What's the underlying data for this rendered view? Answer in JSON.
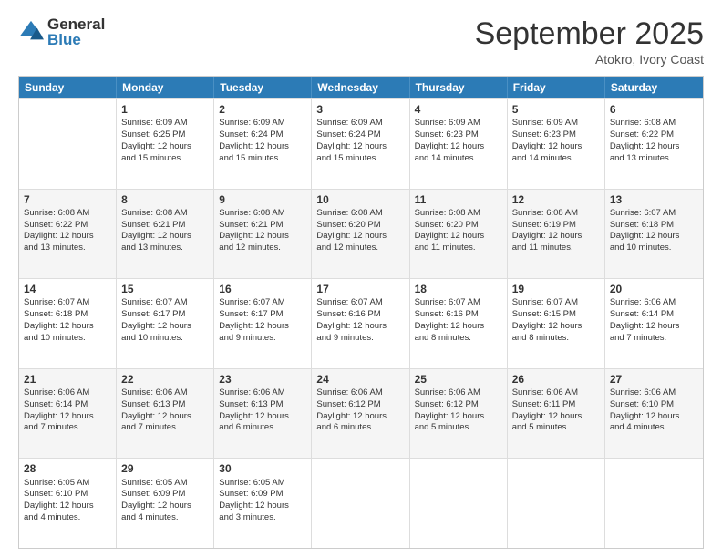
{
  "logo": {
    "general": "General",
    "blue": "Blue"
  },
  "title": "September 2025",
  "subtitle": "Atokro, Ivory Coast",
  "days": [
    "Sunday",
    "Monday",
    "Tuesday",
    "Wednesday",
    "Thursday",
    "Friday",
    "Saturday"
  ],
  "weeks": [
    [
      {
        "day": "",
        "content": ""
      },
      {
        "day": "1",
        "content": "Sunrise: 6:09 AM\nSunset: 6:25 PM\nDaylight: 12 hours\nand 15 minutes."
      },
      {
        "day": "2",
        "content": "Sunrise: 6:09 AM\nSunset: 6:24 PM\nDaylight: 12 hours\nand 15 minutes."
      },
      {
        "day": "3",
        "content": "Sunrise: 6:09 AM\nSunset: 6:24 PM\nDaylight: 12 hours\nand 15 minutes."
      },
      {
        "day": "4",
        "content": "Sunrise: 6:09 AM\nSunset: 6:23 PM\nDaylight: 12 hours\nand 14 minutes."
      },
      {
        "day": "5",
        "content": "Sunrise: 6:09 AM\nSunset: 6:23 PM\nDaylight: 12 hours\nand 14 minutes."
      },
      {
        "day": "6",
        "content": "Sunrise: 6:08 AM\nSunset: 6:22 PM\nDaylight: 12 hours\nand 13 minutes."
      }
    ],
    [
      {
        "day": "7",
        "content": "Sunrise: 6:08 AM\nSunset: 6:22 PM\nDaylight: 12 hours\nand 13 minutes."
      },
      {
        "day": "8",
        "content": "Sunrise: 6:08 AM\nSunset: 6:21 PM\nDaylight: 12 hours\nand 13 minutes."
      },
      {
        "day": "9",
        "content": "Sunrise: 6:08 AM\nSunset: 6:21 PM\nDaylight: 12 hours\nand 12 minutes."
      },
      {
        "day": "10",
        "content": "Sunrise: 6:08 AM\nSunset: 6:20 PM\nDaylight: 12 hours\nand 12 minutes."
      },
      {
        "day": "11",
        "content": "Sunrise: 6:08 AM\nSunset: 6:20 PM\nDaylight: 12 hours\nand 11 minutes."
      },
      {
        "day": "12",
        "content": "Sunrise: 6:08 AM\nSunset: 6:19 PM\nDaylight: 12 hours\nand 11 minutes."
      },
      {
        "day": "13",
        "content": "Sunrise: 6:07 AM\nSunset: 6:18 PM\nDaylight: 12 hours\nand 10 minutes."
      }
    ],
    [
      {
        "day": "14",
        "content": "Sunrise: 6:07 AM\nSunset: 6:18 PM\nDaylight: 12 hours\nand 10 minutes."
      },
      {
        "day": "15",
        "content": "Sunrise: 6:07 AM\nSunset: 6:17 PM\nDaylight: 12 hours\nand 10 minutes."
      },
      {
        "day": "16",
        "content": "Sunrise: 6:07 AM\nSunset: 6:17 PM\nDaylight: 12 hours\nand 9 minutes."
      },
      {
        "day": "17",
        "content": "Sunrise: 6:07 AM\nSunset: 6:16 PM\nDaylight: 12 hours\nand 9 minutes."
      },
      {
        "day": "18",
        "content": "Sunrise: 6:07 AM\nSunset: 6:16 PM\nDaylight: 12 hours\nand 8 minutes."
      },
      {
        "day": "19",
        "content": "Sunrise: 6:07 AM\nSunset: 6:15 PM\nDaylight: 12 hours\nand 8 minutes."
      },
      {
        "day": "20",
        "content": "Sunrise: 6:06 AM\nSunset: 6:14 PM\nDaylight: 12 hours\nand 7 minutes."
      }
    ],
    [
      {
        "day": "21",
        "content": "Sunrise: 6:06 AM\nSunset: 6:14 PM\nDaylight: 12 hours\nand 7 minutes."
      },
      {
        "day": "22",
        "content": "Sunrise: 6:06 AM\nSunset: 6:13 PM\nDaylight: 12 hours\nand 7 minutes."
      },
      {
        "day": "23",
        "content": "Sunrise: 6:06 AM\nSunset: 6:13 PM\nDaylight: 12 hours\nand 6 minutes."
      },
      {
        "day": "24",
        "content": "Sunrise: 6:06 AM\nSunset: 6:12 PM\nDaylight: 12 hours\nand 6 minutes."
      },
      {
        "day": "25",
        "content": "Sunrise: 6:06 AM\nSunset: 6:12 PM\nDaylight: 12 hours\nand 5 minutes."
      },
      {
        "day": "26",
        "content": "Sunrise: 6:06 AM\nSunset: 6:11 PM\nDaylight: 12 hours\nand 5 minutes."
      },
      {
        "day": "27",
        "content": "Sunrise: 6:06 AM\nSunset: 6:10 PM\nDaylight: 12 hours\nand 4 minutes."
      }
    ],
    [
      {
        "day": "28",
        "content": "Sunrise: 6:05 AM\nSunset: 6:10 PM\nDaylight: 12 hours\nand 4 minutes."
      },
      {
        "day": "29",
        "content": "Sunrise: 6:05 AM\nSunset: 6:09 PM\nDaylight: 12 hours\nand 4 minutes."
      },
      {
        "day": "30",
        "content": "Sunrise: 6:05 AM\nSunset: 6:09 PM\nDaylight: 12 hours\nand 3 minutes."
      },
      {
        "day": "",
        "content": ""
      },
      {
        "day": "",
        "content": ""
      },
      {
        "day": "",
        "content": ""
      },
      {
        "day": "",
        "content": ""
      }
    ]
  ]
}
